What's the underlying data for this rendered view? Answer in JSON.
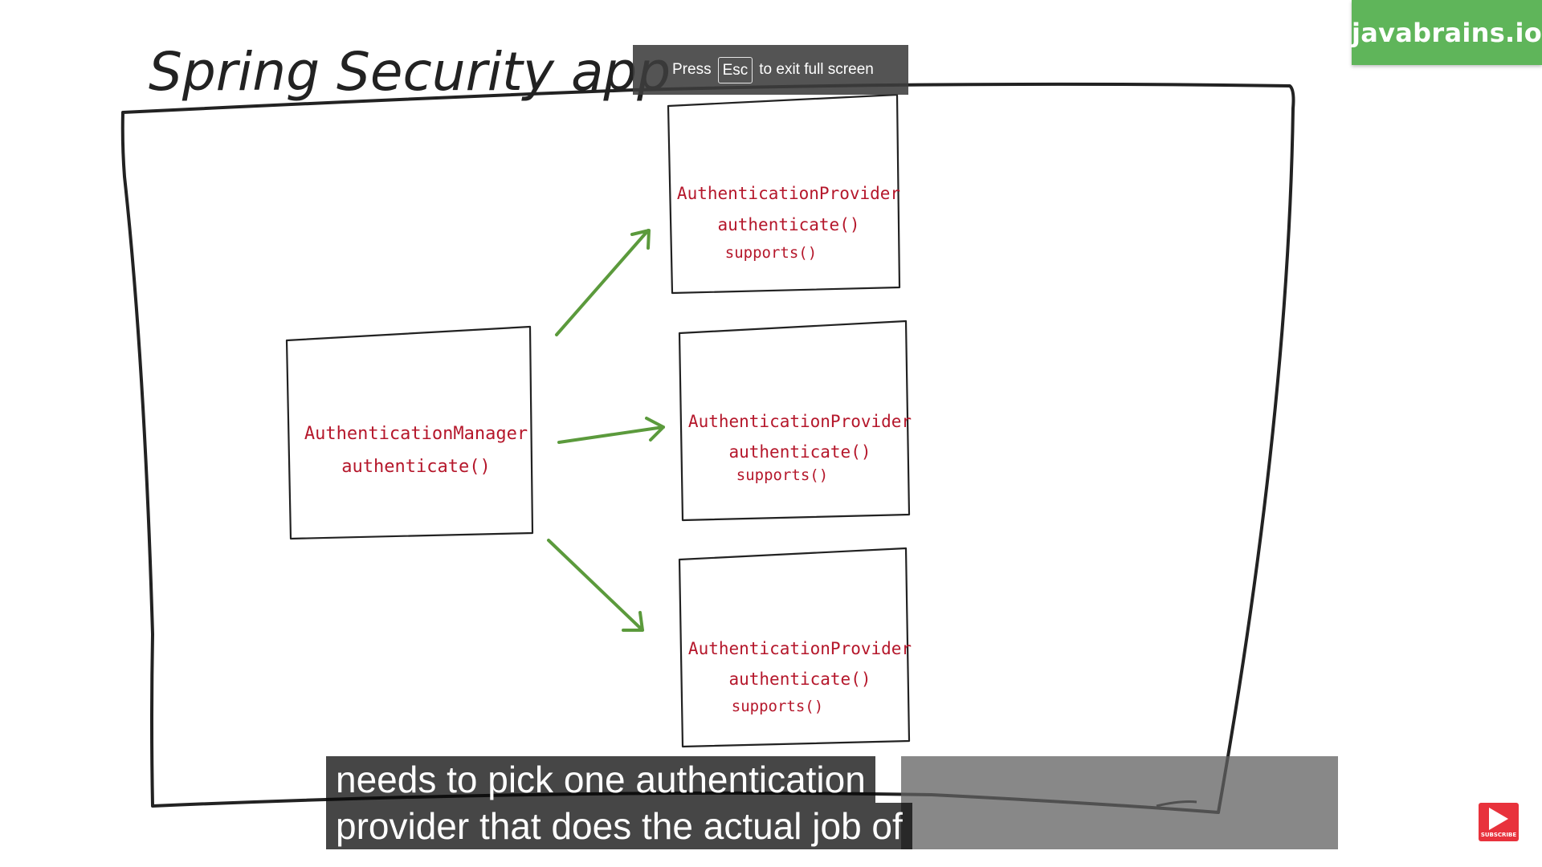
{
  "diagram": {
    "title": "Spring Security app",
    "manager": {
      "name": "AuthenticationManager",
      "method": "authenticate()"
    },
    "providers": [
      {
        "name": "AuthenticationProvider",
        "method1": "authenticate()",
        "method2": "supports()"
      },
      {
        "name": "AuthenticationProvider",
        "method1": "authenticate()",
        "method2": "supports()"
      },
      {
        "name": "AuthenticationProvider",
        "method1": "authenticate()",
        "method2": "supports()"
      }
    ],
    "colors": {
      "ink": "#222222",
      "label": "#b5172b",
      "arrow": "#5b9a3c"
    }
  },
  "overlay": {
    "brand": "javabrains.io",
    "fullscreen_hint": {
      "prefix": "Press",
      "key": "Esc",
      "suffix": "to exit full screen"
    },
    "captions": [
      "needs to pick one authentication",
      "provider that does the actual job of"
    ],
    "subscribe_label": "SUBSCRIBE",
    "subscribe_icon": "play-icon"
  }
}
